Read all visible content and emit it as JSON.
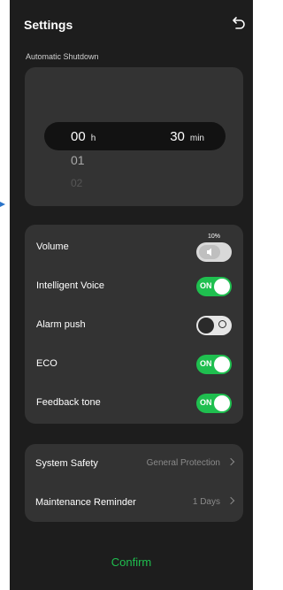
{
  "header": {
    "title": "Settings",
    "back_icon": "back-arrow-icon"
  },
  "auto_shutdown": {
    "label": "Automatic Shutdown",
    "hours_value": "00",
    "hours_unit": "h",
    "minutes_value": "30",
    "minutes_unit": "min",
    "next_value": "01",
    "next_value_2": "02"
  },
  "settings": {
    "volume": {
      "label": "Volume",
      "percent": "10%",
      "level": 0.1
    },
    "intelligent_voice": {
      "label": "Intelligent Voice",
      "state": "ON"
    },
    "alarm_push": {
      "label": "Alarm push",
      "state": "OFF"
    },
    "eco": {
      "label": "ECO",
      "state": "ON"
    },
    "feedback_tone": {
      "label": "Feedback tone",
      "state": "ON"
    }
  },
  "system": {
    "system_safety": {
      "label": "System Safety",
      "value": "General Protection"
    },
    "maintenance": {
      "label": "Maintenance Reminder",
      "value": "1 Days"
    }
  },
  "footer": {
    "confirm_label": "Confirm"
  },
  "colors": {
    "accent_green": "#1fbf4f",
    "background": "#1d1d1d",
    "card": "#333333"
  }
}
